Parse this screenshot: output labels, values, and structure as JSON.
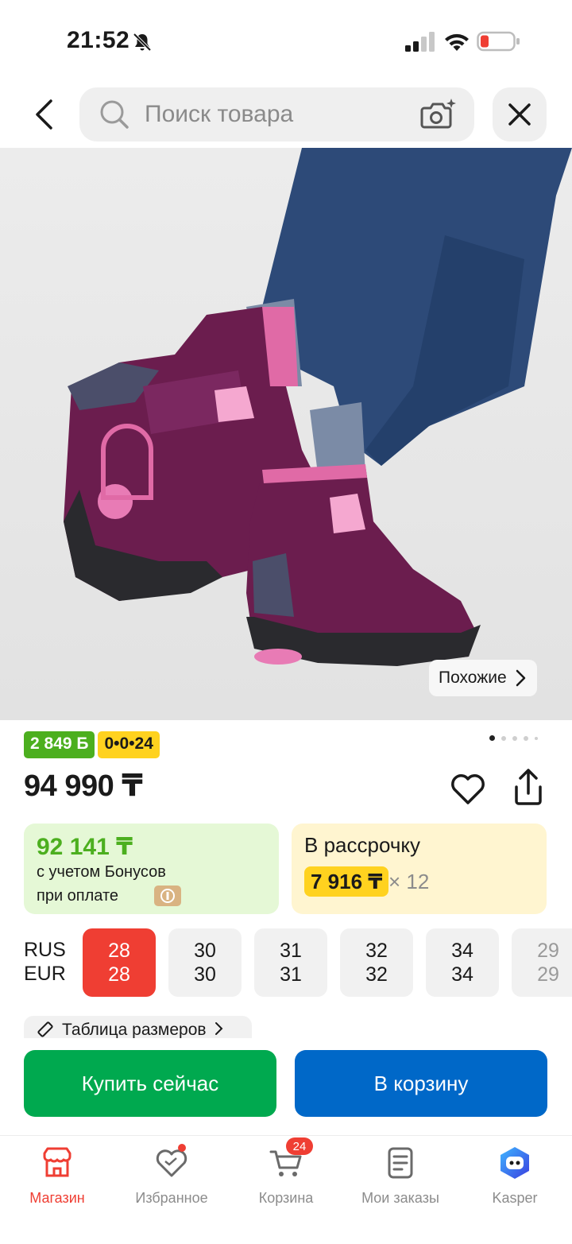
{
  "status_bar": {
    "time": "21:52"
  },
  "search": {
    "placeholder": "Поиск товара"
  },
  "product_image": {
    "similar_label": "Похожие"
  },
  "badges": {
    "bonus": "2 849 Б",
    "installment": "0•0•24"
  },
  "price": "94 990 ₸",
  "bonus_card": {
    "price": "92 141 ₸",
    "line1": "с учетом Бонусов",
    "line2": "при оплате"
  },
  "installment_card": {
    "title": "В рассрочку",
    "monthly": "7 916 ₸",
    "times": "× 12"
  },
  "sizes": {
    "label_rus": "RUS",
    "label_eur": "EUR",
    "items": [
      {
        "rus": "28",
        "eur": "28"
      },
      {
        "rus": "30",
        "eur": "30"
      },
      {
        "rus": "31",
        "eur": "31"
      },
      {
        "rus": "32",
        "eur": "32"
      },
      {
        "rus": "34",
        "eur": "34"
      },
      {
        "rus": "29",
        "eur": "29"
      }
    ],
    "size_table_label": "Таблица размеров"
  },
  "actions": {
    "buy_now": "Купить сейчас",
    "add_to_cart": "В корзину"
  },
  "bottom_nav": {
    "shop": "Магазин",
    "favorites": "Избранное",
    "cart": "Корзина",
    "cart_count": "24",
    "orders": "Мои заказы",
    "assistant": "Kasper"
  },
  "colors": {
    "accent_red": "#ef3e33",
    "bonus_green": "#4caf1f",
    "buy_green": "#00a94f",
    "cart_blue": "#0068c8",
    "installment_yellow": "#ffd21f"
  }
}
